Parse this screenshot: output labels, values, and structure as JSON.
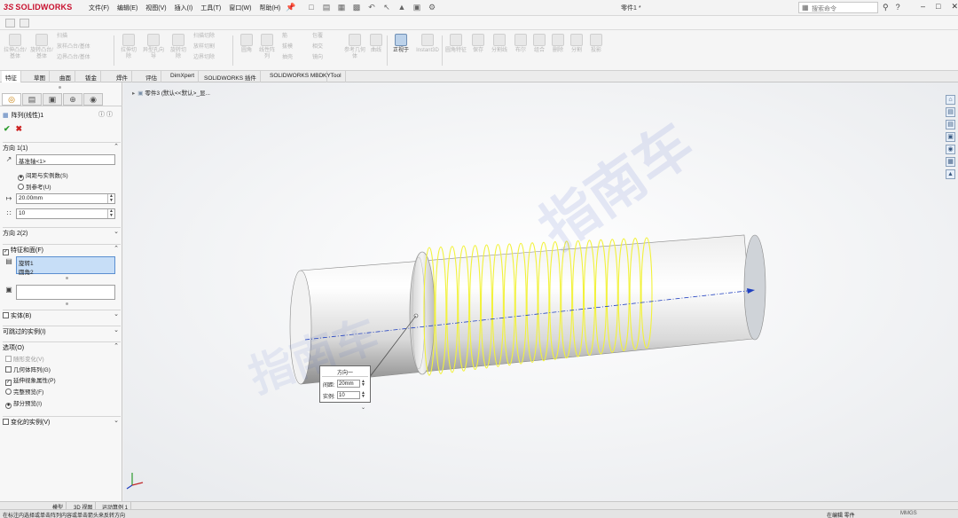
{
  "app": {
    "logo_prefix": "3S",
    "logo_text": "SOLIDWORKS",
    "menu": [
      "文件(F)",
      "编辑(E)",
      "视图(V)",
      "插入(I)",
      "工具(T)",
      "窗口(W)",
      "帮助(H)"
    ],
    "document_title": "零件1 *",
    "search_placeholder": "搜索命令",
    "help_label": "?"
  },
  "ribbon": {
    "buttons": [
      "拉伸凸台/基体",
      "旋转凸台/基体",
      "扫描",
      "放样凸台/基体",
      "边界凸台/基体",
      "拉伸切除",
      "异型孔向导",
      "旋转切除",
      "扫描切除",
      "放样切割",
      "边界切除",
      "圆角",
      "线性阵列",
      "筋",
      "拔模",
      "抽壳",
      "包覆",
      "相交",
      "镜向",
      "参考几何体",
      "曲线",
      "Instant3D",
      "正视于",
      "圆角特征",
      "保存",
      "分割线",
      "布尔",
      "组合",
      "删除",
      "分割",
      "投影"
    ],
    "active_button": "正视于"
  },
  "feature_tabs": {
    "items": [
      "特征",
      "草图",
      "曲面",
      "钣金",
      "焊件",
      "评估",
      "DimXpert",
      "SOLIDWORKS 插件",
      "SOLIDWORKS MBD",
      "KYTool"
    ],
    "active": "特征"
  },
  "property_manager": {
    "title": "阵列(线性)1",
    "direction1": {
      "header": "方向 1(1)",
      "reference": "基准轴<1>",
      "option_spacing": "间距与实例数(S)",
      "option_upto": "到参考(U)",
      "selected_option": "间距与实例数(S)",
      "spacing": "20.00mm",
      "instances": "10"
    },
    "direction2_header": "方向 2(2)",
    "features_header": "特征和面(F)",
    "features_list": [
      "旋转1",
      "圆角2"
    ],
    "bodies_header": "实体(B)",
    "skip_header": "可跳过的实例(I)",
    "options": {
      "header": "选项(O)",
      "vary_sketch": {
        "label": "随形变化(V)",
        "checked": false,
        "enabled": false
      },
      "geometry_pattern": {
        "label": "几何体阵列(G)",
        "checked": false,
        "enabled": true
      },
      "propagate_visual": {
        "label": "延伸视象属性(P)",
        "checked": true,
        "enabled": true
      },
      "full_preview": {
        "label": "完整预览(F)",
        "selected": false
      },
      "partial_preview": {
        "label": "部分预览(I)",
        "selected": true
      }
    },
    "instances_to_vary_header": "变化的实例(V)"
  },
  "feature_tree": {
    "root": "零件3 (默认<<默认>_显..."
  },
  "callout": {
    "title": "方向一",
    "spacing_label": "间距:",
    "spacing_value": "20mm",
    "instances_label": "实例:",
    "instances_value": "10"
  },
  "watermark": "指南车",
  "bottom_tabs": [
    "模型",
    "3D 视图",
    "运动算例 1"
  ],
  "status": {
    "left": "在标注内选择或单击阵列内容或单击箭头来反转方向",
    "mode": "在编辑 零件",
    "unit": "",
    "right": "MMGS"
  },
  "colors": {
    "accent": "#4a76b8",
    "helix": "#f2f23a",
    "axis": "#1f3fbf",
    "ok_green": "#2e9b2e",
    "cancel_red": "#cc2222",
    "logo_red": "#c8102e"
  }
}
